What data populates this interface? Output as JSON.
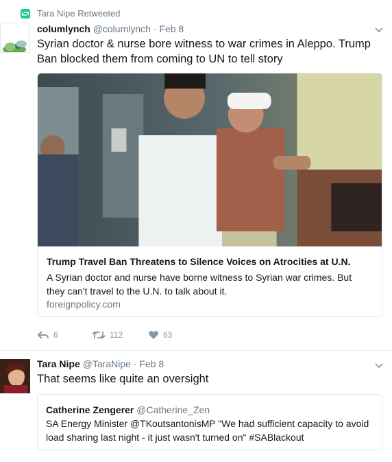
{
  "tweets": [
    {
      "retweet_label": "Tara Nipe Retweeted",
      "name": "columlynch",
      "handle": "@columlynch",
      "separator": "·",
      "date": "Feb 8",
      "text": "Syrian doctor & nurse bore witness to war crimes in Aleppo. Trump Ban blocked them from coming to UN to tell story",
      "card": {
        "image": "photo-doctor-carrying-child",
        "title": "Trump Travel Ban Threatens to Silence Voices on Atrocities at U.N.",
        "description": "A Syrian doctor and nurse have borne witness to Syrian war crimes. But they can't travel to the U.N. to talk about it.",
        "domain": "foreignpolicy.com"
      },
      "actions": {
        "reply_count": "6",
        "retweet_count": "112",
        "like_count": "63"
      }
    },
    {
      "name": "Tara Nipe",
      "handle": "@TaraNipe",
      "separator": "·",
      "date": "Feb 8",
      "text": "That seems like quite an oversight",
      "quote": {
        "name": "Catherine Zengerer",
        "handle": "@Catherine_Zen",
        "text": "SA Energy Minister @TKoutsantonisMP \"We had sufficient capacity to avoid load sharing last night - it just wasn't turned on\" #SABlackout"
      }
    }
  ],
  "colors": {
    "retweet_green": "#19cf86",
    "meta_gray": "#657786",
    "action_gray": "#8899a6",
    "border": "#e1e8ed"
  }
}
